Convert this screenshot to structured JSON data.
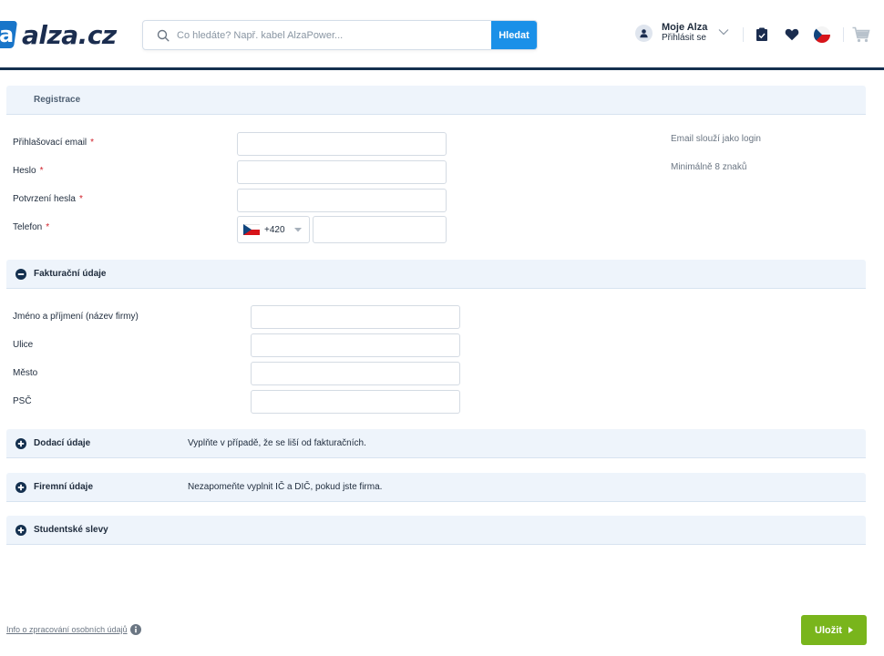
{
  "header": {
    "logo_text": "alza.cz",
    "search_placeholder": "Co hledáte? Např. kabel AlzaPower...",
    "search_button": "Hledat",
    "account_name": "Moje Alza",
    "account_login": "Přihlásit se"
  },
  "registration": {
    "title": "Registrace",
    "email_label": "Přihlašovací email",
    "password_label": "Heslo",
    "password_confirm_label": "Potvrzení hesla",
    "phone_label": "Telefon",
    "required_mark": "*",
    "phone_prefix": "+420",
    "email_hint": "Email slouží jako login",
    "password_hint": "Minimálně 8 znaků"
  },
  "billing": {
    "title": "Fakturační údaje",
    "name_label": "Jméno a příjmení (název firmy)",
    "street_label": "Ulice",
    "city_label": "Město",
    "zip_label": "PSČ"
  },
  "delivery": {
    "title": "Dodací údaje",
    "note": "Vyplňte v případě, že se liší od fakturačních."
  },
  "company": {
    "title": "Firemní údaje",
    "note": "Nezapomeňte vyplnit IČ a DIČ, pokud jste firma."
  },
  "student": {
    "title": "Studentské slevy"
  },
  "footer": {
    "privacy_link": "Info o zpracování osobních údajů",
    "save_button": "Uložit"
  },
  "colors": {
    "brand_blue": "#1875c9",
    "navy": "#14304f",
    "search_button": "#1a90e8",
    "section_bg": "#eef4fb",
    "required": "#d0202a",
    "save_green": "#79b51c"
  }
}
